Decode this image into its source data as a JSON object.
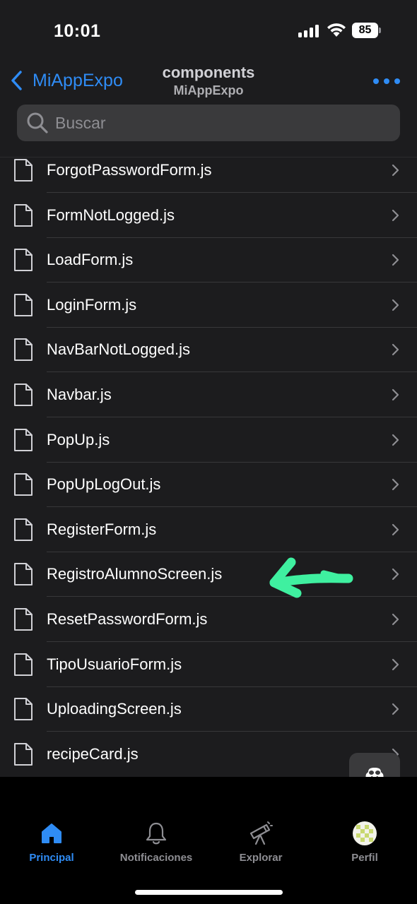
{
  "status_bar": {
    "time": "10:01",
    "battery": "85"
  },
  "nav": {
    "back_label": "MiAppExpo",
    "title": "components",
    "subtitle": "MiAppExpo",
    "more_icon": "ellipsis-icon"
  },
  "search": {
    "placeholder": "Buscar",
    "value": ""
  },
  "files": [
    {
      "name": "ForgotPasswordForm.js"
    },
    {
      "name": "FormNotLogged.js"
    },
    {
      "name": "LoadForm.js"
    },
    {
      "name": "LoginForm.js"
    },
    {
      "name": "NavBarNotLogged.js"
    },
    {
      "name": "Navbar.js"
    },
    {
      "name": "PopUp.js"
    },
    {
      "name": "PopUpLogOut.js"
    },
    {
      "name": "RegisterForm.js"
    },
    {
      "name": "RegistroAlumnoScreen.js"
    },
    {
      "name": "ResetPasswordForm.js"
    },
    {
      "name": "TipoUsuarioForm.js"
    },
    {
      "name": "UploadingScreen.js"
    },
    {
      "name": "recipeCard.js"
    }
  ],
  "annotation": {
    "type": "arrow",
    "points_to": "RegistroAlumnoScreen.js",
    "color": "#3ff0a0"
  },
  "tabs": [
    {
      "label": "Principal",
      "icon": "home-icon",
      "active": true
    },
    {
      "label": "Notificaciones",
      "icon": "bell-icon",
      "active": false
    },
    {
      "label": "Explorar",
      "icon": "telescope-icon",
      "active": false
    },
    {
      "label": "Perfil",
      "icon": "avatar-icon",
      "active": false
    }
  ],
  "colors": {
    "accent": "#2f8cf5",
    "background": "#1c1c1e",
    "tab_bar": "#000000"
  }
}
